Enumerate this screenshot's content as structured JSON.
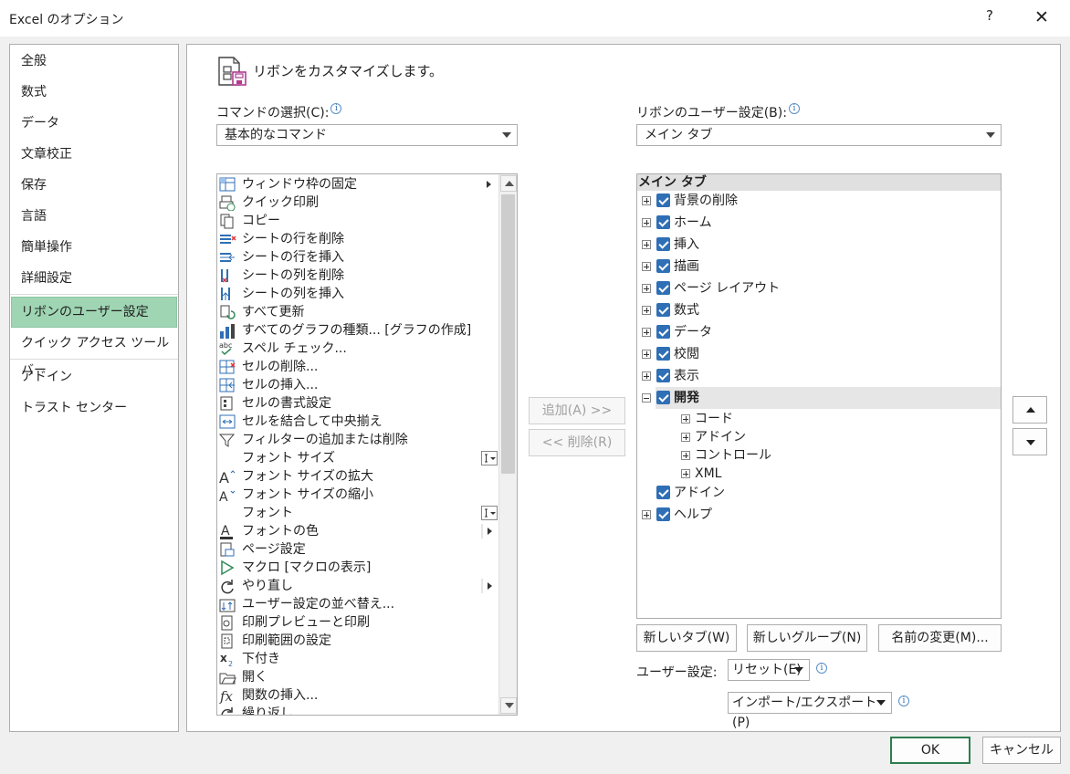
{
  "window": {
    "title": "Excel のオプション",
    "help_label": "?",
    "close_label": "✕"
  },
  "sidebar": {
    "items": [
      {
        "label": "全般"
      },
      {
        "label": "数式"
      },
      {
        "label": "データ"
      },
      {
        "label": "文章校正"
      },
      {
        "label": "保存"
      },
      {
        "label": "言語"
      },
      {
        "label": "簡単操作"
      },
      {
        "label": "詳細設定"
      },
      {
        "label": "リボンのユーザー設定",
        "selected": true
      },
      {
        "label": "クイック アクセス ツール バー"
      },
      {
        "label": "アドイン"
      },
      {
        "label": "トラスト センター"
      }
    ]
  },
  "header": {
    "text": "リボンをカスタマイズします。"
  },
  "commands": {
    "label": "コマンドの選択(C):",
    "dropdown_value": "基本的なコマンド",
    "items": [
      {
        "label": "ウィンドウ枠の固定",
        "icon": "freeze-panes-icon",
        "side": "submenu"
      },
      {
        "label": "クイック印刷",
        "icon": "quick-print-icon"
      },
      {
        "label": "コピー",
        "icon": "copy-icon"
      },
      {
        "label": "シートの行を削除",
        "icon": "delete-row-icon"
      },
      {
        "label": "シートの行を挿入",
        "icon": "insert-row-icon"
      },
      {
        "label": "シートの列を削除",
        "icon": "delete-column-icon"
      },
      {
        "label": "シートの列を挿入",
        "icon": "insert-column-icon"
      },
      {
        "label": "すべて更新",
        "icon": "refresh-all-icon"
      },
      {
        "label": "すべてのグラフの種類... [グラフの作成]",
        "icon": "chart-icon"
      },
      {
        "label": "スペル チェック...",
        "icon": "spelling-icon"
      },
      {
        "label": "セルの削除...",
        "icon": "delete-cells-icon"
      },
      {
        "label": "セルの挿入...",
        "icon": "insert-cells-icon"
      },
      {
        "label": "セルの書式設定",
        "icon": "format-cells-icon"
      },
      {
        "label": "セルを結合して中央揃え",
        "icon": "merge-center-icon"
      },
      {
        "label": "フィルターの追加または削除",
        "icon": "filter-icon"
      },
      {
        "label": "フォント サイズ",
        "icon": "",
        "side": "textbox"
      },
      {
        "label": "フォント サイズの拡大",
        "icon": "font-grow-icon"
      },
      {
        "label": "フォント サイズの縮小",
        "icon": "font-shrink-icon"
      },
      {
        "label": "フォント",
        "icon": "",
        "side": "textbox"
      },
      {
        "label": "フォントの色",
        "icon": "font-color-icon",
        "side": "split"
      },
      {
        "label": "ページ設定",
        "icon": "page-setup-icon"
      },
      {
        "label": "マクロ [マクロの表示]",
        "icon": "macro-icon"
      },
      {
        "label": "やり直し",
        "icon": "redo-icon",
        "side": "split"
      },
      {
        "label": "ユーザー設定の並べ替え...",
        "icon": "custom-sort-icon"
      },
      {
        "label": "印刷プレビューと印刷",
        "icon": "print-preview-icon"
      },
      {
        "label": "印刷範囲の設定",
        "icon": "print-area-icon"
      },
      {
        "label": "下付き",
        "icon": "subscript-icon"
      },
      {
        "label": "開く",
        "icon": "open-icon"
      },
      {
        "label": "関数の挿入...",
        "icon": "function-icon"
      },
      {
        "label": "繰り返し",
        "icon": "repeat-icon"
      }
    ]
  },
  "middle": {
    "add_label": "追加(A) >>",
    "remove_label": "<< 削除(R)"
  },
  "ribbon": {
    "label": "リボンのユーザー設定(B):",
    "dropdown_value": "メイン タブ",
    "tree_header": "メイン タブ",
    "tabs": [
      {
        "label": "背景の削除",
        "expander": "plus",
        "checked": true
      },
      {
        "label": "ホーム",
        "expander": "plus",
        "checked": true
      },
      {
        "label": "挿入",
        "expander": "plus",
        "checked": true
      },
      {
        "label": "描画",
        "expander": "plus",
        "checked": true
      },
      {
        "label": "ページ レイアウト",
        "expander": "plus",
        "checked": true
      },
      {
        "label": "数式",
        "expander": "plus",
        "checked": true
      },
      {
        "label": "データ",
        "expander": "plus",
        "checked": true
      },
      {
        "label": "校閲",
        "expander": "plus",
        "checked": true
      },
      {
        "label": "表示",
        "expander": "plus",
        "checked": true
      },
      {
        "label": "開発",
        "expander": "minus",
        "checked": true,
        "selected": true
      },
      {
        "label": "コード",
        "expander": "plus",
        "child": true
      },
      {
        "label": "アドイン",
        "expander": "plus",
        "child": true
      },
      {
        "label": "コントロール",
        "expander": "plus",
        "child": true
      },
      {
        "label": "XML",
        "expander": "plus",
        "child": true
      },
      {
        "label": "アドイン",
        "expander": "none",
        "checked": true
      },
      {
        "label": "ヘルプ",
        "expander": "plus",
        "checked": true
      }
    ],
    "new_tab_label": "新しいタブ(W)",
    "new_group_label": "新しいグループ(N)",
    "rename_label": "名前の変更(M)...",
    "customize_label": "ユーザー設定:",
    "reset_label": "リセット(E)",
    "import_export_label": "インポート/エクスポート(P)"
  },
  "footer": {
    "ok_label": "OK",
    "cancel_label": "キャンセル"
  },
  "colors": {
    "selected_nav": "#9fd5b3",
    "checkbox": "#2f6fb5",
    "default_button_border": "#2d7d4f"
  }
}
